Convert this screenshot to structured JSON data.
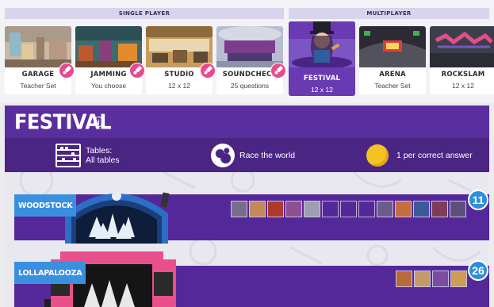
{
  "modes": {
    "single_header": "SINGLE PLAYER",
    "multi_header": "MULTIPLAYER",
    "single": [
      {
        "name": "GARAGE",
        "sub": "Teacher Set"
      },
      {
        "name": "JAMMING",
        "sub": "You choose"
      },
      {
        "name": "STUDIO",
        "sub": "12 x 12"
      },
      {
        "name": "SOUNDCHECK",
        "sub": "25 questions"
      }
    ],
    "multi": [
      {
        "name": "FESTIVAL",
        "sub": "12 x 12"
      },
      {
        "name": "ARENA",
        "sub": "Teacher Set"
      },
      {
        "name": "ROCKSLAM",
        "sub": "12 x 12"
      }
    ]
  },
  "panel": {
    "title": "FESTIVAL",
    "info_glyph": "i",
    "rules": {
      "tables_label": "Tables:",
      "tables_value": "All tables",
      "race": "Race the world",
      "coins": "1 per correct answer"
    }
  },
  "lanes": [
    {
      "name": "WOODSTOCK",
      "count": "11"
    },
    {
      "name": "LOLLAPALOOZA",
      "count": "26"
    }
  ],
  "icons": {
    "guitar": "guitar-icon",
    "info": "info-icon",
    "abacus": "abacus-icon",
    "globe": "globe-icon",
    "coin": "coin-icon"
  }
}
